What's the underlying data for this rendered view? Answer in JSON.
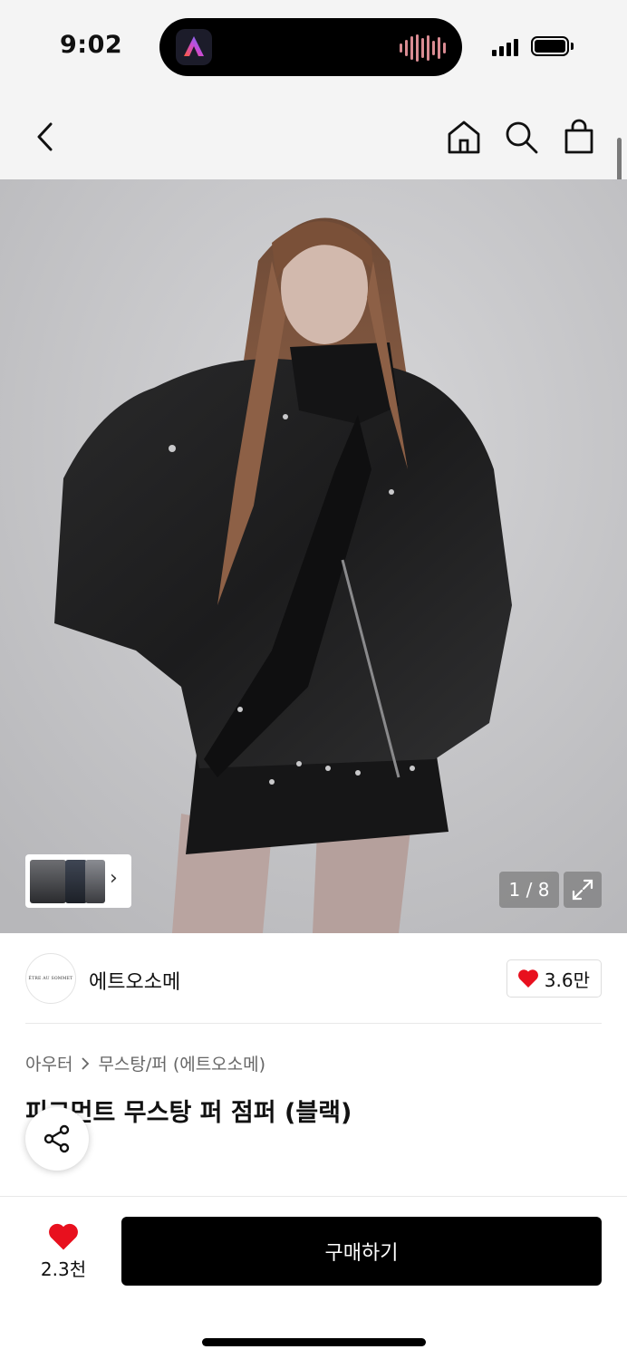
{
  "status_bar": {
    "time": "9:02"
  },
  "nav": {
    "back_icon": "chevron-left-icon",
    "home_icon": "home-icon",
    "search_icon": "search-icon",
    "cart_icon": "shopping-bag-icon"
  },
  "gallery": {
    "page_indicator": "1 / 8",
    "thumbnail_arrow": "›",
    "expand_icon": "expand-icon"
  },
  "brand": {
    "logo_text": "ÊTRE AU SOMMET",
    "name": "에트오소메",
    "like_count": "3.6만"
  },
  "product": {
    "breadcrumb": [
      "아우터",
      "무스탕/퍼 (에트오소메)"
    ],
    "title": "피그먼트 무스탕 퍼 점퍼 (블랙)"
  },
  "bottom_bar": {
    "wish_count": "2.3천",
    "buy_label": "구매하기"
  },
  "colors": {
    "accent": "#000000",
    "heart": "#e8101e"
  }
}
